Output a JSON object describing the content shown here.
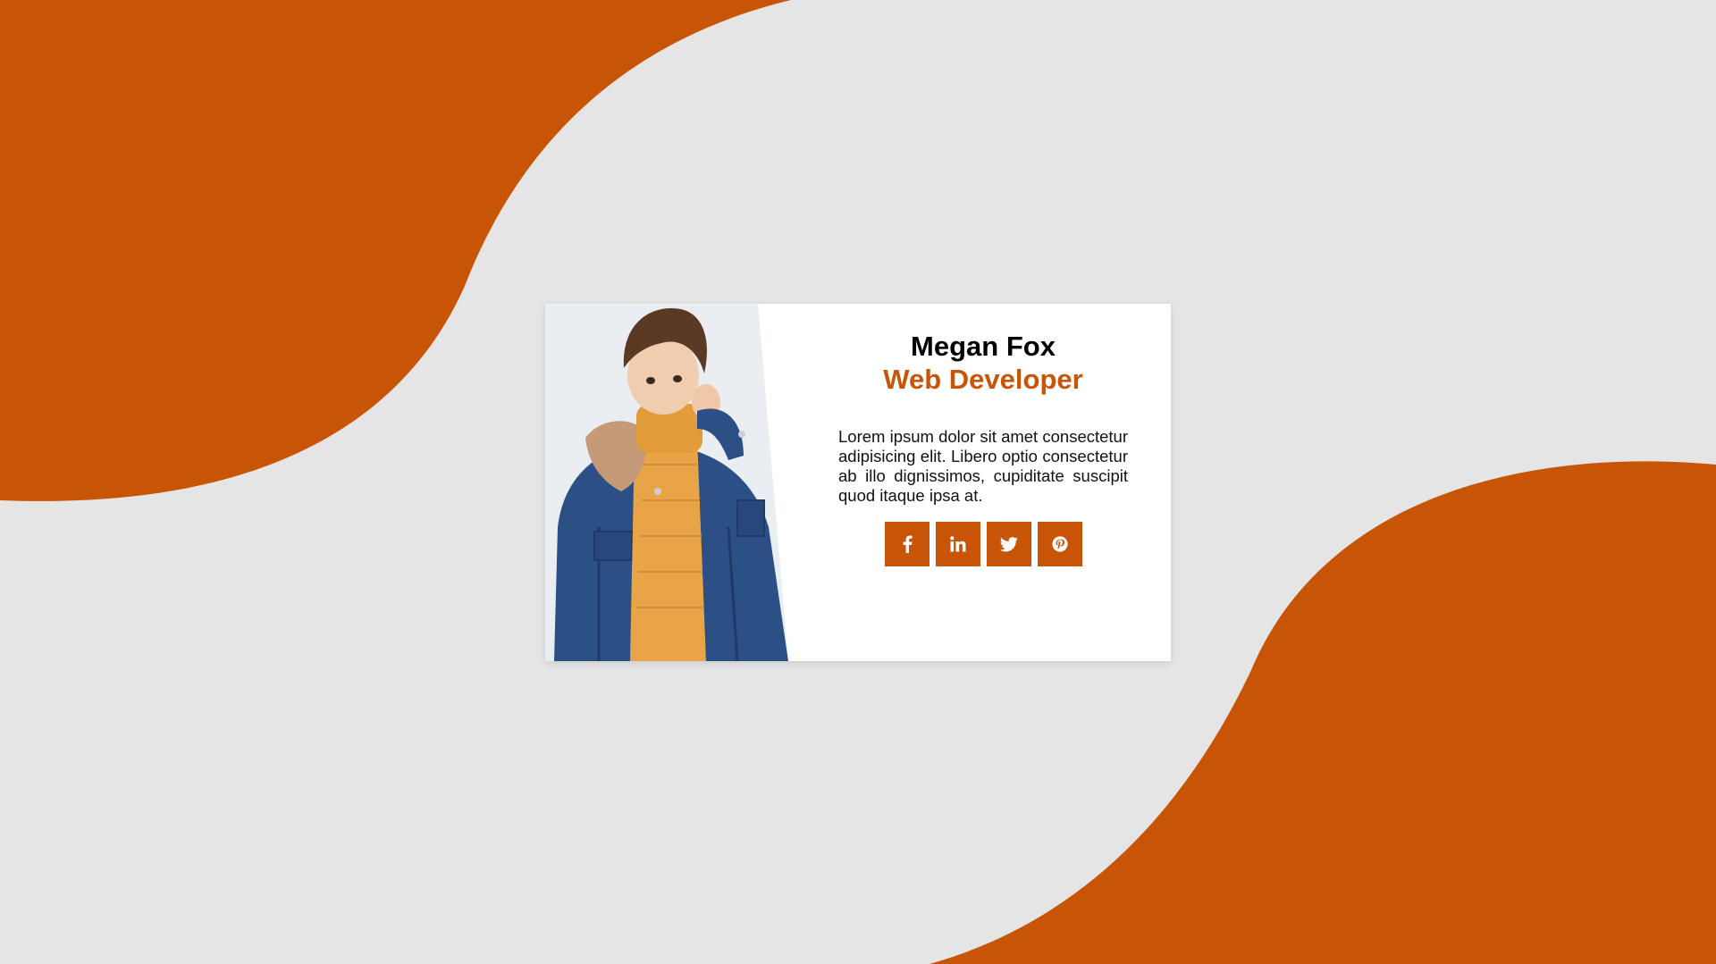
{
  "theme": {
    "accent": "#c85406",
    "background": "#e5e5e5",
    "card_background": "#ffffff"
  },
  "profile": {
    "photo_icon": "person-photo",
    "name": "Megan Fox",
    "role": "Web Developer",
    "bio": "Lorem ipsum dolor sit amet consectetur adipisicing elit. Libero optio consectetur ab illo dignissimos, cupiditate suscipit quod itaque ipsa at."
  },
  "socials": [
    {
      "icon": "facebook-icon"
    },
    {
      "icon": "linkedin-icon"
    },
    {
      "icon": "twitter-icon"
    },
    {
      "icon": "pinterest-icon"
    }
  ]
}
